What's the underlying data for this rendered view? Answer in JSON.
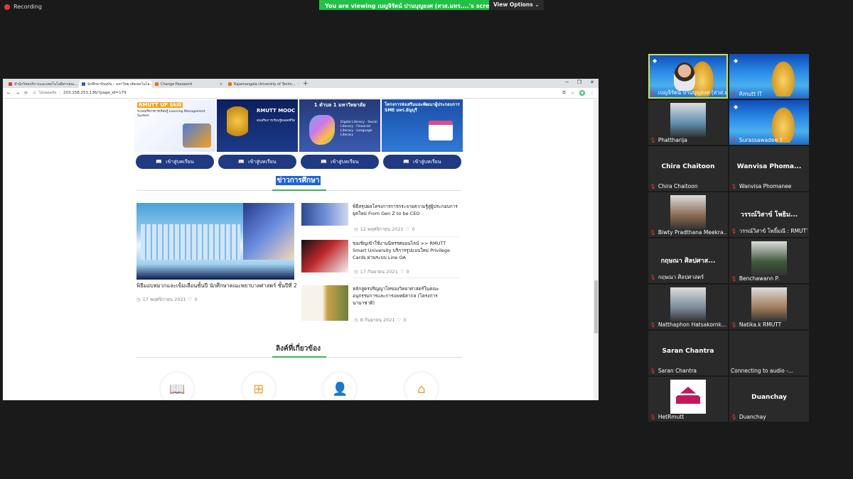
{
  "zoom": {
    "recording": "Recording",
    "banner": "You are viewing เบญจิรัตน์ ปานบุญยงศ (สวส.มทร....'s screen",
    "view_options": "View Options ⌄"
  },
  "browser": {
    "tabs": [
      {
        "label": "สำนักวิทยบริการและเทคโนโลยีสารสนเ...",
        "active": false,
        "color": "#d23f31"
      },
      {
        "label": "นักศึกษาปัจจุบัน – มหาวิทยาลัยเทคโนโล...",
        "active": true,
        "color": "#1c62d8"
      },
      {
        "label": "Change Password",
        "active": false,
        "color": "#e8710a"
      },
      {
        "label": "Rajamangala University of Techn...",
        "active": false,
        "color": "#e8710a"
      }
    ],
    "new_tab": "+",
    "window_controls": [
      "─",
      "❐",
      "✕"
    ],
    "security_label": "ไม่ปลอดภัย",
    "url": "203.158.253.136/?page_id=179",
    "nav": [
      "←",
      "→",
      "⟳"
    ]
  },
  "page": {
    "cards": [
      {
        "title": "RMUTT UP Skill",
        "subtitle": "ระบบบริหารการเรียนรู้ Learning Management System"
      },
      {
        "title": "RMUTT MOOC",
        "subtitle": "ส่งเสริมการเรียนรู้ตลอดชีวิต"
      },
      {
        "title": "1 ตำบล 1 มหาวิทยาลัย",
        "subtitle": "Digital Literacy · Social Literacy · Financial Literacy · Language Literacy"
      },
      {
        "title": "โครงการส่งเสริมและพัฒนาผู้ประกอบการ SME มทร.ธัญบุรี",
        "subtitle": ""
      }
    ],
    "enter_button": "เข้าสู่บทเรียน",
    "news_heading": "ข่าวการศึกษา",
    "main_news": {
      "title": "พิธีมอบหมวกและเข็มเลื่อนชั้นปี นักศึกษาคณะพยาบาลศาสตร์ ชั้นปีที่ 2",
      "date": "17 พฤศจิกายน 2021",
      "likes": "0"
    },
    "news": [
      {
        "title": "พิธีสรุปผลโครงการการกระจายความรู้สู่ผู้ประกอบการยุคใหม่ From Gen Z to be CEO",
        "date": "12 พฤศจิกายน 2021",
        "likes": "0"
      },
      {
        "title": "ขอเชิญเข้าใช้งานนิทรรศออนไลน์ >> RMUTT Smart University บริการรูปแบบใหม่ Privilege Cards ผ่านระบบ Line OA",
        "date": "17 กันยายน 2021",
        "likes": "0"
      },
      {
        "title": "หลักสูตรปริญญาโทของวิทยาศาสตร์ในคณะอนุกรรมการและการแพทย์สากล (โครงการนานาชาติ)",
        "date": "8 กันยายน 2021",
        "likes": "0"
      }
    ],
    "links_heading": "ลิงค์ที่เกี่ยวข้อง"
  },
  "participants": [
    {
      "name": "เบญจิรัตน์ ปานบุญยงศ (สวส.มทร....",
      "center": "",
      "type": "rmutt",
      "active": true
    },
    {
      "name": "Rmutt IT",
      "center": "",
      "type": "rmutt",
      "active": false
    },
    {
      "name": "Phattharija",
      "center": "",
      "type": "photo",
      "active": false
    },
    {
      "name": "Surassawadee Y",
      "center": "",
      "type": "rmutt",
      "active": false
    },
    {
      "name": "Chira Chaitoon",
      "center": "Chira Chaitoon",
      "type": "text",
      "active": false
    },
    {
      "name": "Wanvisa Phomanee",
      "center": "Wanvisa Phoma...",
      "type": "text",
      "active": false
    },
    {
      "name": "Biwty Pradthana Meekra...",
      "center": "",
      "type": "photo",
      "active": false
    },
    {
      "name": "วรรณ์วิสาข์ โพธิ์มณี : RMUTT",
      "center": "วรรณ์วิสาข์ โพธิม...",
      "type": "text",
      "active": false
    },
    {
      "name": "กฤษณา ศิลปศาสตร์",
      "center": "กฤษณา ศิลปศาส...",
      "type": "text",
      "active": false
    },
    {
      "name": "Benchawann P.",
      "center": "",
      "type": "photo",
      "active": false
    },
    {
      "name": "Natthaphon Hatsakornk...",
      "center": "",
      "type": "photo",
      "active": false
    },
    {
      "name": "Natika.k RMUTT",
      "center": "",
      "type": "photo",
      "active": false
    },
    {
      "name": "Saran Chantra",
      "center": "Saran Chantra",
      "type": "text",
      "active": false
    },
    {
      "name": "Connecting to audio -...",
      "center": "",
      "type": "blank",
      "active": false
    },
    {
      "name": "HetRmutt",
      "center": "",
      "type": "logo",
      "active": false
    },
    {
      "name": "Duanchay",
      "center": "Duanchay",
      "type": "text",
      "active": false
    }
  ]
}
